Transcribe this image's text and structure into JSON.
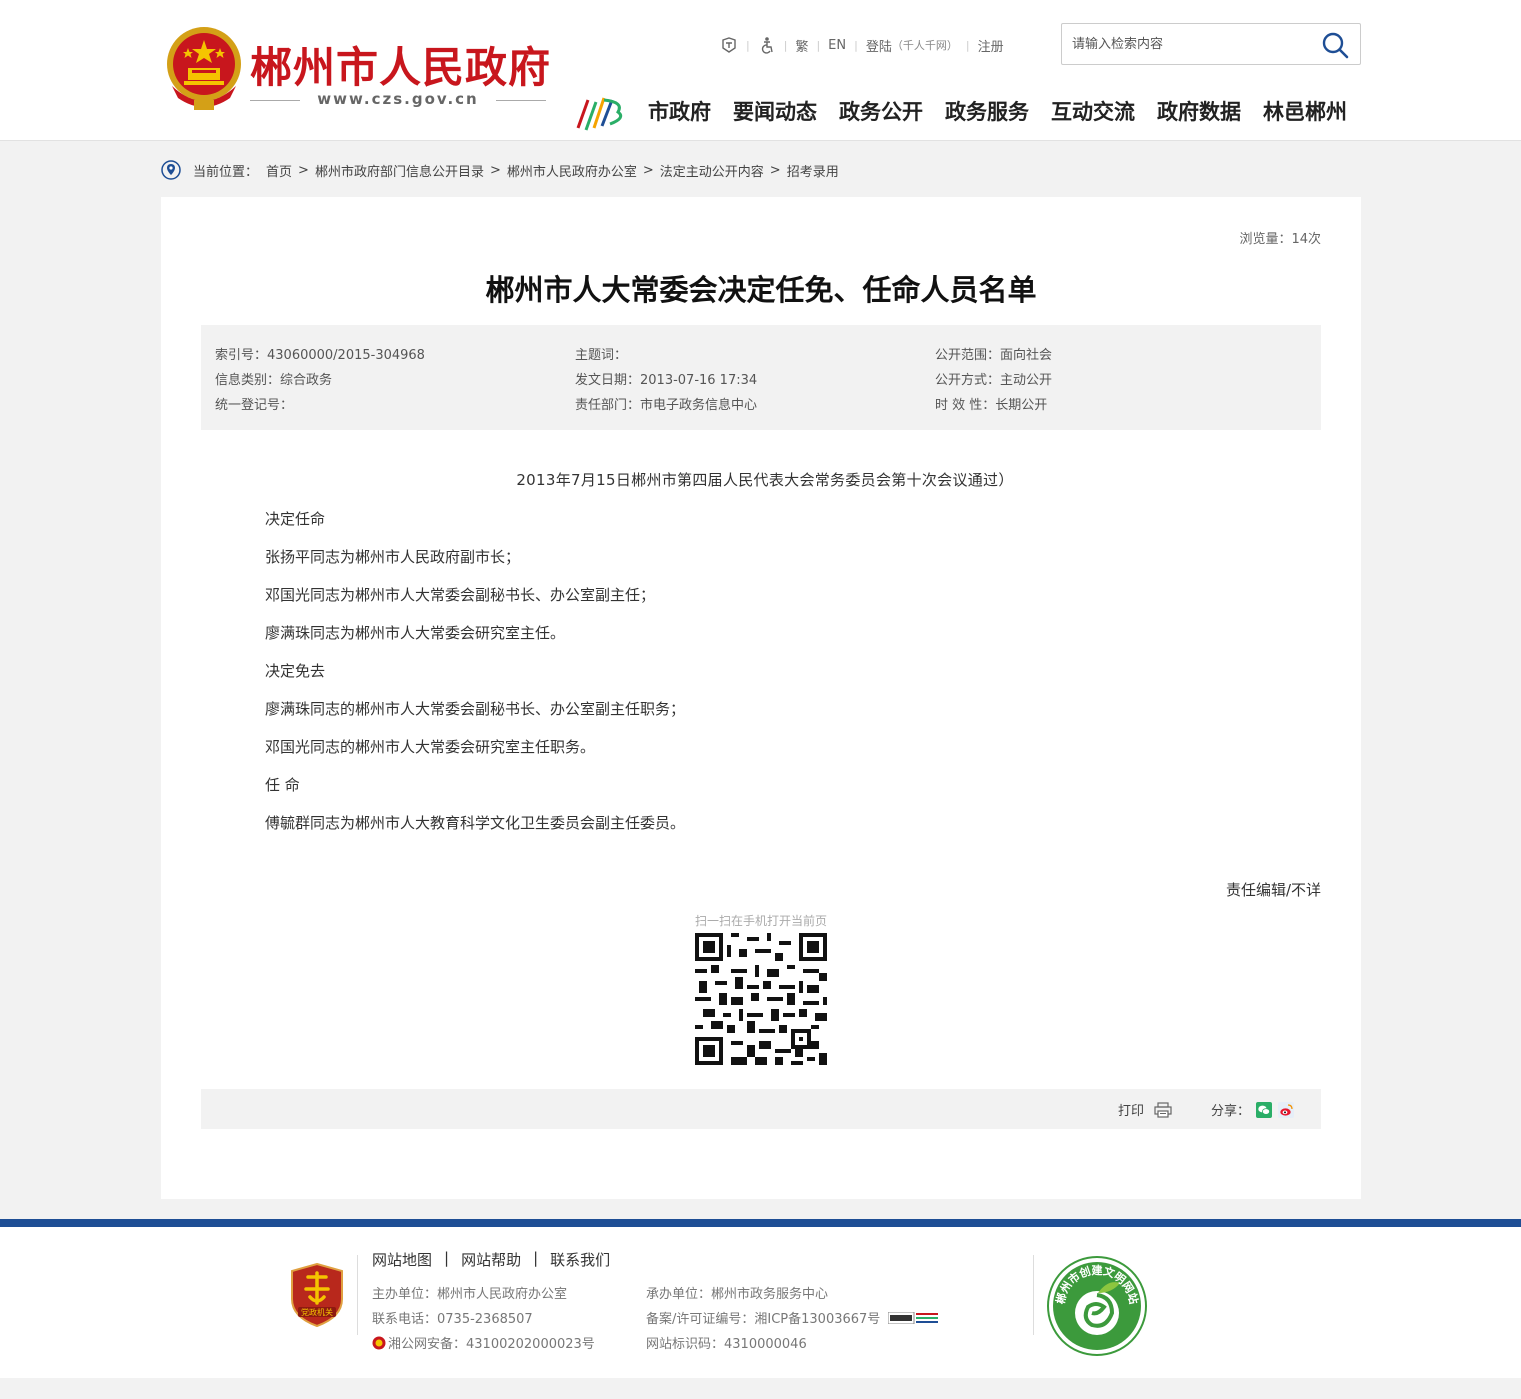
{
  "header": {
    "site_name": "郴州市人民政府",
    "site_url": "www.czs.gov.cn",
    "toplinks": {
      "traditional": "繁",
      "english": "EN",
      "login": "登陆",
      "login_note": "（千人千网）",
      "register": "注册"
    },
    "search": {
      "placeholder": "请输入检索内容"
    },
    "nav": [
      "市政府",
      "要闻动态",
      "政务公开",
      "政务服务",
      "互动交流",
      "政府数据",
      "林邑郴州"
    ]
  },
  "breadcrumb": {
    "label": "当前位置：",
    "items": [
      "首页",
      "郴州市政府部门信息公开目录",
      "郴州市人民政府办公室",
      "法定主动公开内容",
      "招考录用"
    ],
    "separator": ">"
  },
  "article": {
    "views": "浏览量：14次",
    "title": "郴州市人大常委会决定任免、任命人员名单",
    "meta": {
      "index_no": "索引号：43060000/2015-304968",
      "info_category": "信息类别：综合政务",
      "unified_reg_no": "统一登记号：",
      "keywords": "主题词：",
      "publish_date": "发文日期：2013-07-16 17:34",
      "department": "责任部门：市电子政务信息中心",
      "scope": "公开范围：面向社会",
      "method": "公开方式：主动公开",
      "validity": "时 效 性：长期公开"
    },
    "intro": "2013年7月15日郴州市第四届人民代表大会常务委员会第十次会议通过）",
    "paragraphs": [
      "决定任命",
      "张扬平同志为郴州市人民政府副市长；",
      "邓国光同志为郴州市人大常委会副秘书长、办公室副主任；",
      "廖满珠同志为郴州市人大常委会研究室主任。",
      "决定免去",
      "廖满珠同志的郴州市人大常委会副秘书长、办公室副主任职务；",
      "邓国光同志的郴州市人大常委会研究室主任职务。",
      "任 命",
      "傅毓群同志为郴州市人大教育科学文化卫生委员会副主任委员。"
    ],
    "editor": "责任编辑/不详",
    "qr_caption": "扫一扫在手机打开当前页",
    "print_label": "打印",
    "share_label": "分享："
  },
  "footer": {
    "links": [
      "网站地图",
      "网站帮助",
      "联系我们"
    ],
    "link_separator": "|",
    "host": "主办单位：郴州市人民政府办公室",
    "phone": "联系电话：0735-2368507",
    "police": "湘公网安备：43100202000023号",
    "operator": "承办单位：郴州市政务服务中心",
    "icp": "备案/许可证编号：湘ICP备13003667号",
    "site_id": "网站标识码：4310000046",
    "party_badge": "党政机关",
    "civ_badge": "郴州市创建文明网站"
  },
  "colors": {
    "brand_red": "#c8161d",
    "footer_blue": "#1e4e95",
    "wechat_green": "#2aae67"
  }
}
